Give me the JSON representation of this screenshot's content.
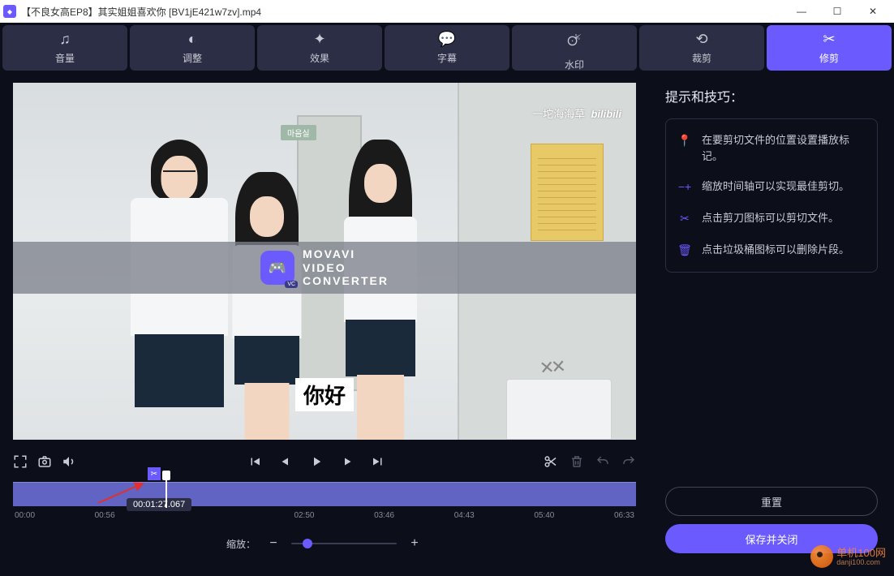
{
  "window": {
    "title": "【不良女高EP8】其实姐姐喜欢你 [BV1jE421w7zv].mp4"
  },
  "toolbar": {
    "tabs": [
      {
        "label": "音量"
      },
      {
        "label": "调整"
      },
      {
        "label": "效果"
      },
      {
        "label": "字幕"
      },
      {
        "label": "水印"
      },
      {
        "label": "裁剪"
      },
      {
        "label": "修剪"
      }
    ]
  },
  "preview": {
    "sign": "마음실",
    "bili_user": "一坨海海草",
    "bili_logo": "bilibili",
    "watermark_line1": "MOVAVI",
    "watermark_line2": "VIDEO",
    "watermark_line3": "CONVERTER",
    "watermark_badge": "VC",
    "subtitle": "你好"
  },
  "timeline": {
    "current_time": "00:01:27.067",
    "ticks": [
      "00:00",
      "00:56",
      "",
      "",
      "02:50",
      "03:46",
      "04:43",
      "05:40",
      "06:33"
    ],
    "zoom_label": "缩放："
  },
  "tips": {
    "title": "提示和技巧：",
    "items": [
      "在要剪切文件的位置设置播放标记。",
      "缩放时间轴可以实现最佳剪切。",
      "点击剪刀图标可以剪切文件。",
      "点击垃圾桶图标可以删除片段。"
    ]
  },
  "buttons": {
    "reset": "重置",
    "save": "保存并关闭"
  },
  "site_watermark": {
    "name": "单机100网",
    "url": "danji100.com"
  }
}
